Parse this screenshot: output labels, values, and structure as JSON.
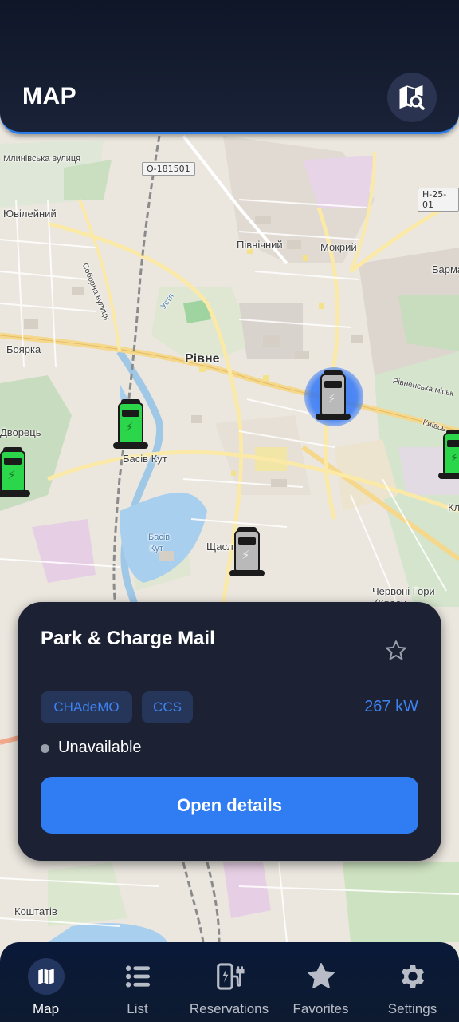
{
  "header": {
    "title": "MAP",
    "map_search_icon": "map-search-icon"
  },
  "map": {
    "labels": {
      "mlynivska": "Млинівська вулиця",
      "yuvileinyi": "Ювілейний",
      "pivnichnyi": "Північний",
      "mokryi": "Мокрий",
      "barma": "Барма",
      "boiarka": "Боярка",
      "rivne": "Рівне",
      "dvorets": "Дворець",
      "basiv_kut": "Басів Кут",
      "basiv_kut_lake_1": "Басів",
      "basiv_kut_lake_2": "Кут",
      "shchasl": "Щасл",
      "chervoni_hory": "Червоні Гори",
      "krasni": "(Красн",
      "koshtativ": "Коштатів",
      "rivnenska": "Рівненська міськ",
      "kyivska": "Київсь",
      "sobornа": "Соборна вулиця",
      "ustia": "Устя",
      "kl": "Кл"
    },
    "shields": {
      "o18": "О-181501",
      "h25": "Н-25-01"
    },
    "markers": [
      {
        "name": "charger-marker-1",
        "status": "available",
        "color": "#2bd64a"
      },
      {
        "name": "charger-marker-2",
        "status": "available",
        "color": "#2bd64a"
      },
      {
        "name": "charger-marker-3",
        "status": "available",
        "color": "#2bd64a"
      },
      {
        "name": "charger-marker-selected",
        "status": "selected",
        "color": "#3478f6"
      },
      {
        "name": "charger-marker-4",
        "status": "unavailable",
        "color": "#b9b9b9"
      }
    ]
  },
  "station": {
    "name": "Park & Charge Mail",
    "connectors": [
      "CHAdeMO",
      "CCS"
    ],
    "power": "267 kW",
    "status": "Unavailable",
    "open_details": "Open details",
    "favorite_icon": "star-outline-icon"
  },
  "nav": {
    "items": [
      {
        "label": "Map",
        "icon": "map-icon",
        "active": true
      },
      {
        "label": "List",
        "icon": "list-icon",
        "active": false
      },
      {
        "label": "Reservations",
        "icon": "charging-station-icon",
        "active": false
      },
      {
        "label": "Favorites",
        "icon": "star-icon",
        "active": false
      },
      {
        "label": "Settings",
        "icon": "gear-icon",
        "active": false
      }
    ]
  },
  "colors": {
    "accent": "#2f7cf3",
    "card": "#1c2234",
    "header": "#0f1628",
    "chip": "#26365a",
    "available": "#2bd64a",
    "unavailable": "#9aa1ad"
  }
}
